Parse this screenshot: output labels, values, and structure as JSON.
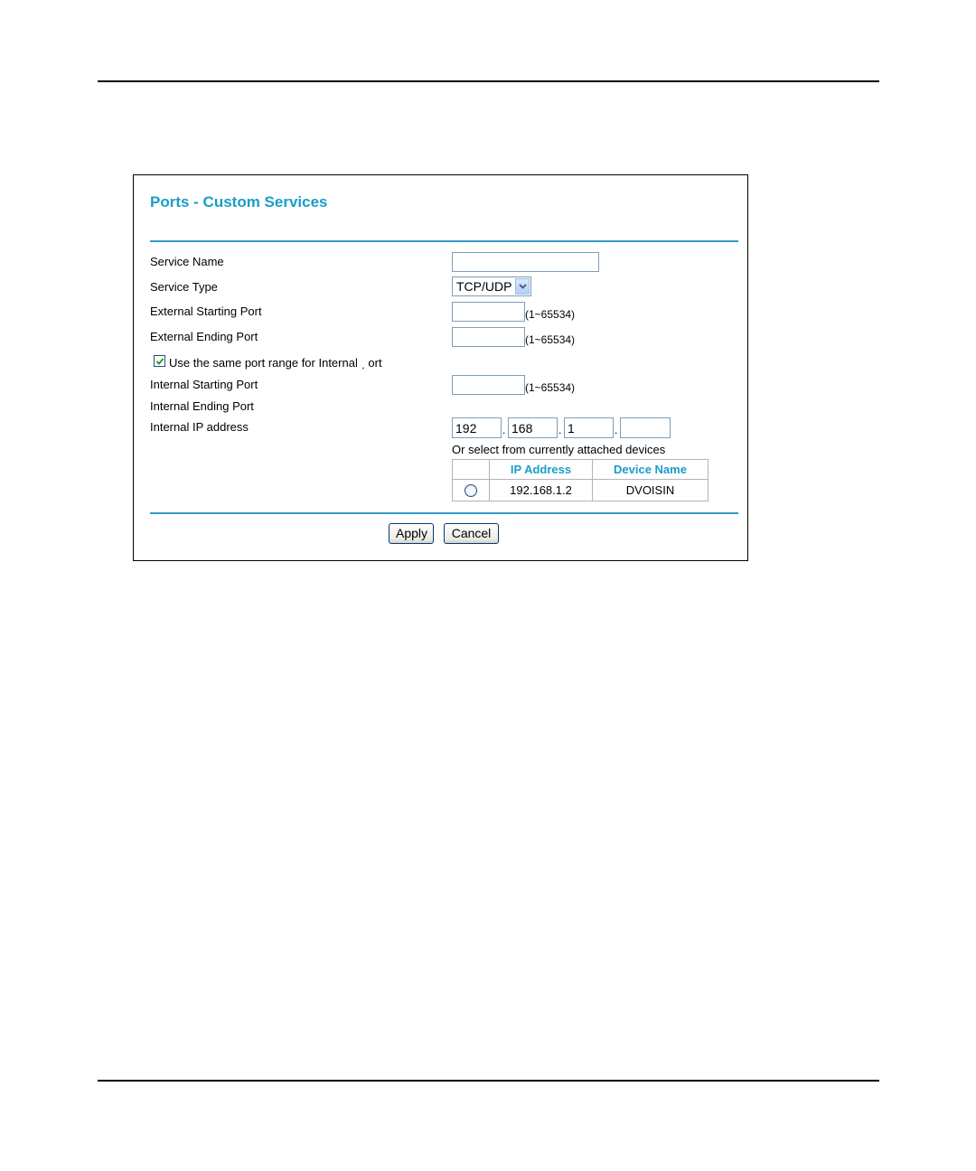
{
  "page": {
    "title": "Ports - Custom Services"
  },
  "form": {
    "service_name": {
      "label": "Service Name",
      "value": ""
    },
    "service_type": {
      "label": "Service Type",
      "selected": "TCP/UDP"
    },
    "external_starting_port": {
      "label": "External Starting Port",
      "value": "",
      "range": "(1~65534)"
    },
    "external_ending_port": {
      "label": "External Ending Port",
      "value": "",
      "range": "(1~65534)"
    },
    "same_range_checkbox": {
      "label": "Use the same port range for Internal ˏ ort",
      "checked": true
    },
    "internal_starting_port": {
      "label": "Internal Starting Port",
      "value": "",
      "range": "(1~65534)"
    },
    "internal_ending_port": {
      "label": "Internal Ending Port"
    },
    "internal_ip": {
      "label": "Internal IP address",
      "octets": [
        "192",
        "168",
        "1",
        ""
      ],
      "separator": "."
    },
    "attached_devices_note": "Or select from currently attached devices"
  },
  "devices_table": {
    "headers": [
      "",
      "IP Address",
      "Device Name"
    ],
    "rows": [
      {
        "ip": "192.168.1.2",
        "name": "DVOISIN"
      }
    ]
  },
  "buttons": {
    "apply": "Apply",
    "cancel": "Cancel"
  },
  "colors": {
    "accent": "#1a9ec6",
    "divider": "#3399cc"
  }
}
